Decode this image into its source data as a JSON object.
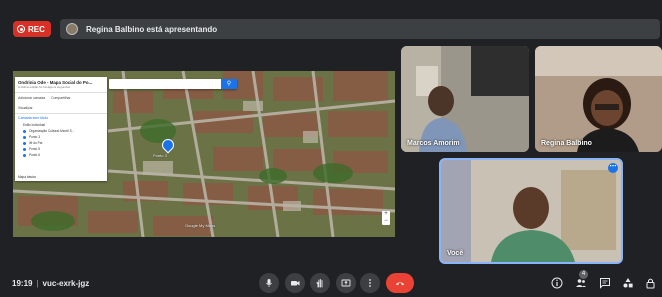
{
  "topbar": {
    "rec_label": "REC",
    "presenting_text": "Regina Balbino está apresentando"
  },
  "map": {
    "panel_title": "Ondrinia Ode - Mapa Social do Po...",
    "panel_subtitle": "A última edição foi há alguns segundos",
    "action_add_layer": "Adicionar camada",
    "action_share": "Compartilhar",
    "action_preview": "Visualizar",
    "layer_label": "Camada sem título",
    "layer_items": [
      "Estilo individual",
      "Organização Cultural Ahoeti S...",
      "Ponto 3",
      "Ilê do Pai",
      "Ponto 5",
      "Ponto 6"
    ],
    "base_map_label": "Mapa básico",
    "pin_label": "Ponto 3",
    "search_icon": "search-icon",
    "google_label": "Google My Maps",
    "zoom_in": "+",
    "zoom_out": "−"
  },
  "participants": [
    {
      "name": "Marcos Amorim"
    },
    {
      "name": "Regina Balbino"
    },
    {
      "name": "Você"
    }
  ],
  "bottombar": {
    "time": "19:19",
    "meeting_code": "vuc-exrk-jgz",
    "people_count": "4"
  },
  "colors": {
    "end_call": "#ea4335",
    "rec": "#d93025",
    "self_tile_border": "#8ab4f8"
  }
}
